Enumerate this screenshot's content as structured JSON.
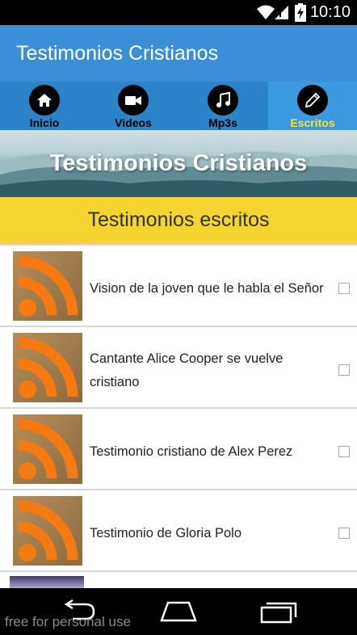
{
  "status_bar": {
    "time": "10:10"
  },
  "app_bar": {
    "title": "Testimonios Cristianos"
  },
  "tabs": [
    {
      "label": "Inicio",
      "icon": "home-icon",
      "active": false
    },
    {
      "label": "Videos",
      "icon": "video-camera-icon",
      "active": false
    },
    {
      "label": "Mp3s",
      "icon": "music-note-icon",
      "active": false
    },
    {
      "label": "Escritos",
      "icon": "pencil-icon",
      "active": true
    }
  ],
  "banner": {
    "title": "Testimonios Cristianos"
  },
  "section": {
    "title": "Testimonios escritos"
  },
  "items": [
    {
      "title": "Vision de la joven que le habla el Señor",
      "thumb": "rss-feed-icon"
    },
    {
      "title": "Cantante Alice Cooper se vuelve cristiano",
      "thumb": "rss-feed-icon"
    },
    {
      "title": "Testimonio cristiano de Alex Perez",
      "thumb": "rss-feed-icon"
    },
    {
      "title": "Testimonio de Gloria Polo",
      "thumb": "rss-feed-icon"
    }
  ],
  "watermark": "free for personal use",
  "colors": {
    "app_bar": "#3c8fd6",
    "tabs": "#2c84c8",
    "active_tab": "#3c98df",
    "active_tab_label": "#f7e23c",
    "section_header": "#f5d331",
    "rss_orange": "#f57a12"
  }
}
